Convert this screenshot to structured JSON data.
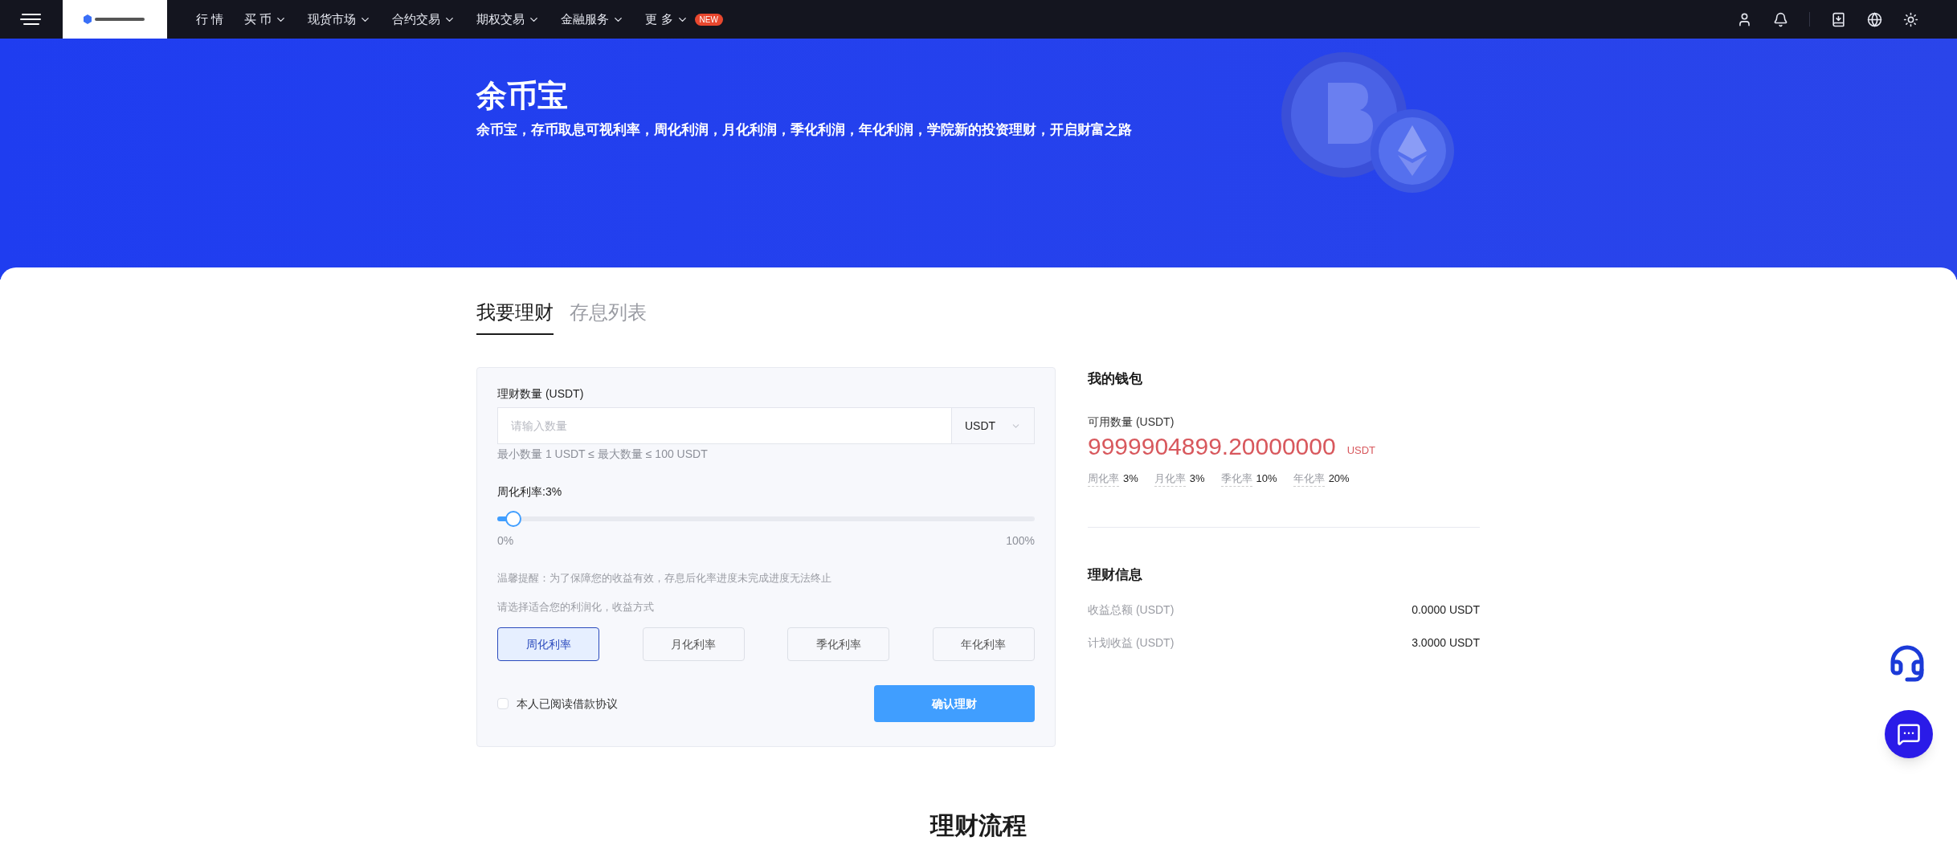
{
  "nav": {
    "menu": [
      {
        "label": "行 情",
        "caret": false
      },
      {
        "label": "买 币",
        "caret": true
      },
      {
        "label": "现货市场",
        "caret": true
      },
      {
        "label": "合约交易",
        "caret": true
      },
      {
        "label": "期权交易",
        "caret": true
      },
      {
        "label": "金融服务",
        "caret": true
      },
      {
        "label": "更 多",
        "caret": true,
        "badge": "NEW"
      }
    ]
  },
  "hero": {
    "title": "余币宝",
    "subtitle": "余币宝，存币取息可视利率，周化利润，月化利润，季化利润，年化利润，学院新的投资理财，开启财富之路"
  },
  "tabs": [
    {
      "label": "我要理财",
      "selected": true
    },
    {
      "label": "存息列表",
      "selected": false
    }
  ],
  "form": {
    "amount_label": "理财数量 (USDT)",
    "placeholder": "请输入数量",
    "currency": "USDT",
    "limit_hint": "最小数量 1 USDT ≤ 最大数量 ≤ 100 USDT",
    "rate_label": "周化利率:3%",
    "slider": {
      "level": 0.03,
      "min_label": "0%",
      "max_label": "100%"
    },
    "notice": "温馨提醒：为了保障您的收益有效，存息后化率进度未完成进度无法终止",
    "choose_hint": "请选择适合您的利润化，收益方式",
    "options": [
      {
        "label": "周化利率",
        "selected": true
      },
      {
        "label": "月化利率",
        "selected": false
      },
      {
        "label": "季化利率",
        "selected": false
      },
      {
        "label": "年化利率",
        "selected": false
      }
    ],
    "agreement": {
      "label": "本人已阅读借款协议",
      "checked": false
    },
    "submit": "确认理财"
  },
  "wallet": {
    "title": "我的钱包",
    "available_label": "可用数量 (USDT)",
    "balance": "9999904899.20000000",
    "balance_unit": "USDT",
    "rates": [
      {
        "label": "周化率",
        "value": "3%"
      },
      {
        "label": "月化率",
        "value": "3%"
      },
      {
        "label": "季化率",
        "value": "10%"
      },
      {
        "label": "年化率",
        "value": "20%"
      }
    ]
  },
  "info": {
    "title": "理财信息",
    "rows": [
      {
        "label": "收益总额 (USDT)",
        "value": "0.0000 USDT"
      },
      {
        "label": "计划收益 (USDT)",
        "value": "3.0000 USDT"
      }
    ]
  },
  "process_title": "理财流程"
}
